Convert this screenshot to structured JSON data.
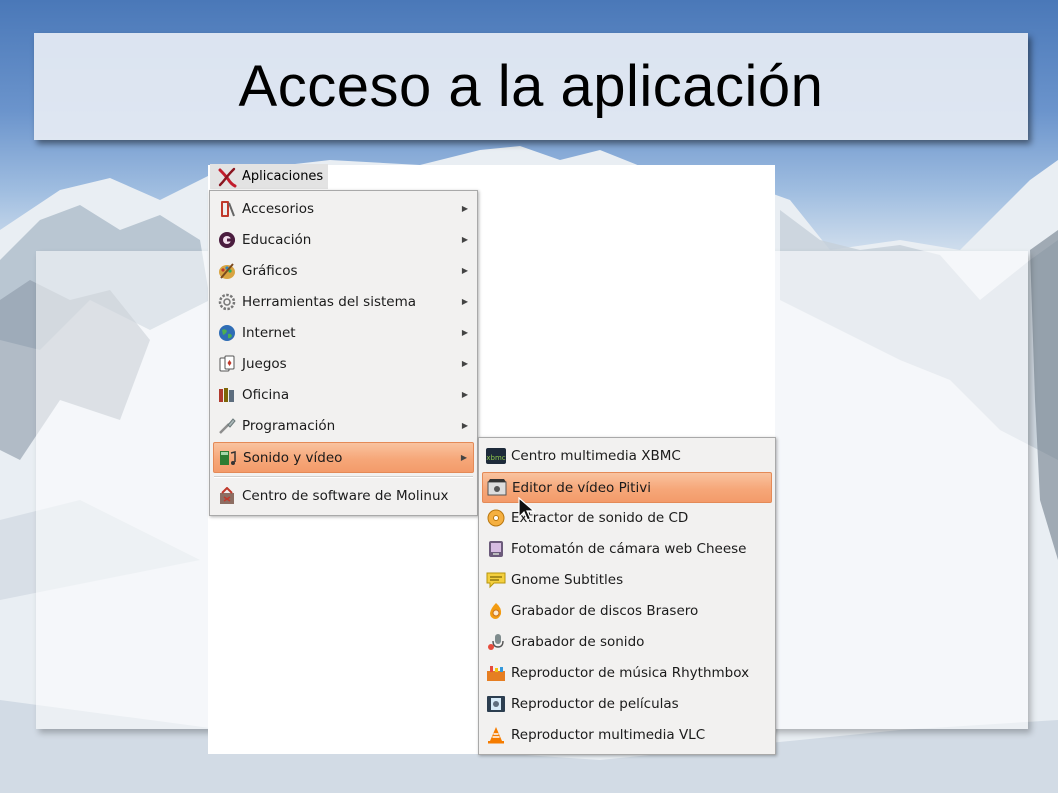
{
  "slide": {
    "title": "Acceso a la aplicación"
  },
  "panel": {
    "apps_label": "Aplicaciones"
  },
  "main_menu": {
    "items": [
      {
        "label": "Accesorios",
        "icon": "accessories-icon"
      },
      {
        "label": "Educación",
        "icon": "education-icon"
      },
      {
        "label": "Gráficos",
        "icon": "graphics-icon"
      },
      {
        "label": "Herramientas del sistema",
        "icon": "system-tools-icon"
      },
      {
        "label": "Internet",
        "icon": "internet-globe-icon"
      },
      {
        "label": "Juegos",
        "icon": "games-cards-icon"
      },
      {
        "label": "Oficina",
        "icon": "office-icon"
      },
      {
        "label": "Programación",
        "icon": "programming-icon"
      },
      {
        "label": "Sonido y vídeo",
        "icon": "sound-video-icon"
      }
    ],
    "software_center": {
      "label": "Centro de software de Molinux",
      "icon": "software-center-icon"
    }
  },
  "sub_menu": {
    "items": [
      {
        "label": "Centro multimedia XBMC",
        "icon": "xbmc-icon"
      },
      {
        "label": "Editor de vídeo Pitivi",
        "icon": "pitivi-icon"
      },
      {
        "label": "Extractor de sonido de CD",
        "icon": "cd-extractor-icon"
      },
      {
        "label": "Fotomatón de cámara web Cheese",
        "icon": "cheese-icon"
      },
      {
        "label": "Gnome Subtitles",
        "icon": "subtitles-icon"
      },
      {
        "label": "Grabador de discos Brasero",
        "icon": "brasero-icon"
      },
      {
        "label": "Grabador de sonido",
        "icon": "sound-recorder-icon"
      },
      {
        "label": "Reproductor de música Rhythmbox",
        "icon": "rhythmbox-icon"
      },
      {
        "label": "Reproductor de películas",
        "icon": "movie-player-icon"
      },
      {
        "label": "Reproductor multimedia VLC",
        "icon": "vlc-icon"
      }
    ]
  },
  "colors": {
    "highlight": "#f6a779",
    "menu_bg": "#f2f1f0",
    "sky": "#4a78b8"
  }
}
